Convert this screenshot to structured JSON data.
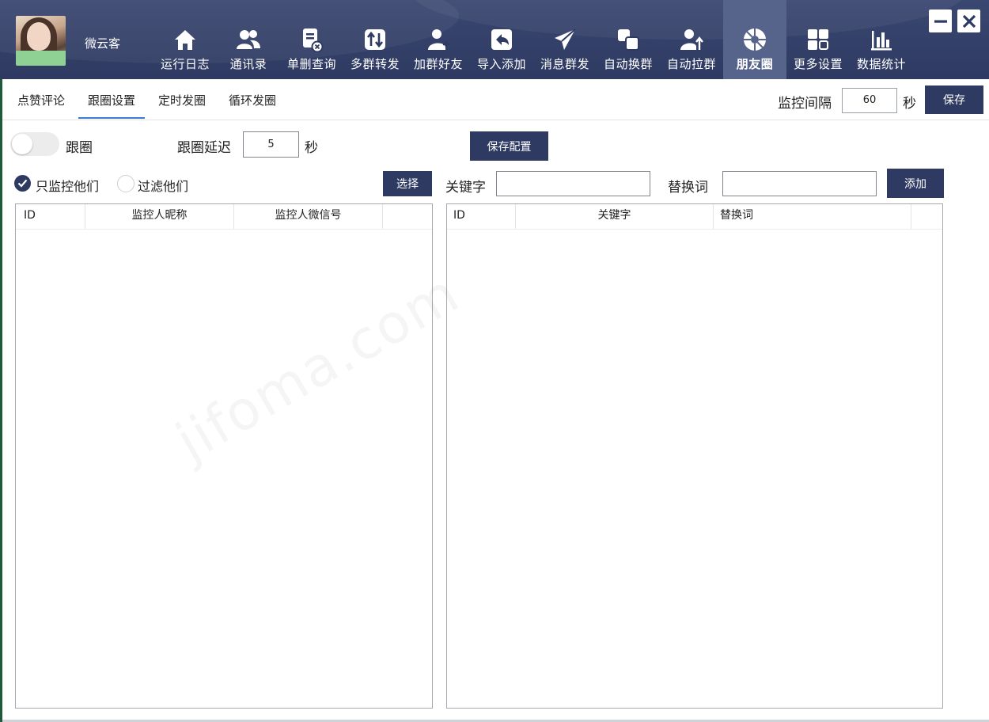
{
  "user": {
    "name": "微云客"
  },
  "nav": {
    "items": [
      {
        "label": "运行日志",
        "icon": "home-icon"
      },
      {
        "label": "通讯录",
        "icon": "contacts-icon"
      },
      {
        "label": "单删查询",
        "icon": "delete-check-icon"
      },
      {
        "label": "多群转发",
        "icon": "transfer-icon"
      },
      {
        "label": "加群好友",
        "icon": "add-friend-icon"
      },
      {
        "label": "导入添加",
        "icon": "import-icon"
      },
      {
        "label": "消息群发",
        "icon": "send-icon"
      },
      {
        "label": "自动换群",
        "icon": "swap-group-icon"
      },
      {
        "label": "自动拉群",
        "icon": "pull-group-icon"
      },
      {
        "label": "朋友圈",
        "icon": "moments-icon",
        "active": true
      },
      {
        "label": "更多设置",
        "icon": "grid-icon"
      },
      {
        "label": "数据统计",
        "icon": "chart-icon"
      }
    ]
  },
  "tabs": [
    {
      "label": "点赞评论"
    },
    {
      "label": "跟圈设置",
      "active": true
    },
    {
      "label": "定时发圈"
    },
    {
      "label": "循环发圈"
    }
  ],
  "monitor": {
    "label": "监控间隔",
    "value": "60",
    "unit": "秒",
    "save_label": "保存"
  },
  "follow": {
    "toggle_label": "跟圈",
    "toggle_on": false,
    "delay_label": "跟圈延迟",
    "delay_value": "5",
    "delay_unit": "秒",
    "save_config_label": "保存配置"
  },
  "filter": {
    "option_only": "只监控他们",
    "option_filter": "过滤他们",
    "selected": "只监控他们",
    "select_label": "选择"
  },
  "keyword": {
    "keyword_label": "关键字",
    "replace_label": "替换词",
    "keyword_value": "",
    "replace_value": "",
    "add_label": "添加"
  },
  "left_table": {
    "columns": [
      "ID",
      "监控人昵称",
      "监控人微信号"
    ],
    "rows": []
  },
  "right_table": {
    "columns": [
      "ID",
      "关键字",
      "替换词"
    ],
    "rows": []
  },
  "watermark": "jifoma.com",
  "colors": {
    "header": "#2e3a62",
    "active_nav": "#56648b",
    "tab_underline": "#3b7bd8"
  }
}
